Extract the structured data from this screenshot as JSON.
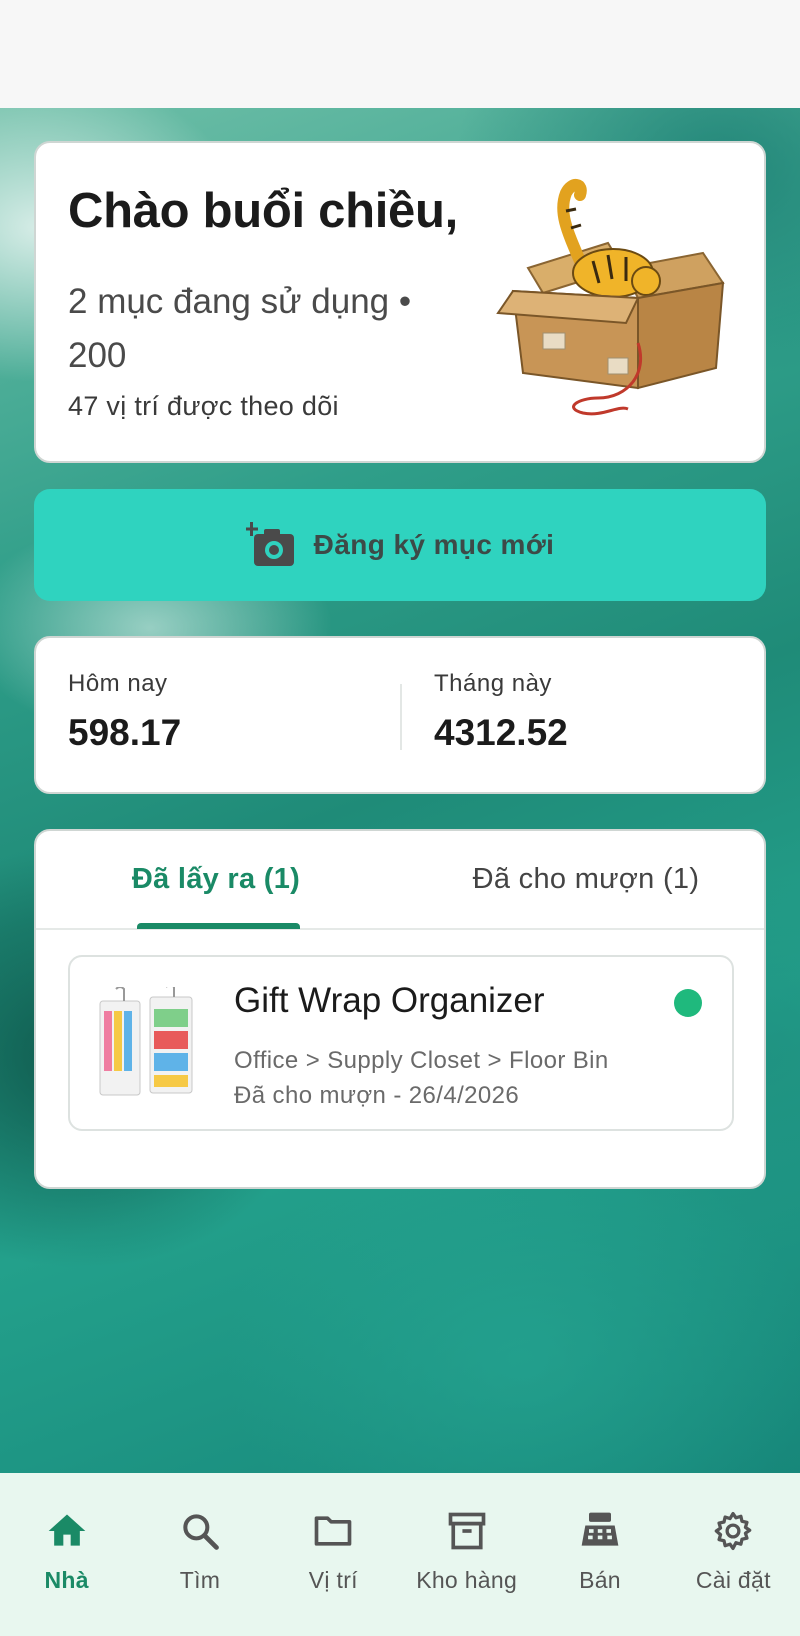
{
  "greeting": {
    "title": "Chào buổi chiều,",
    "items_line": "2 mục đang sử dụng • 200",
    "locations_line": "47 vị trí được theo dõi"
  },
  "register_button": {
    "label": "Đăng ký mục mới",
    "icon": "add-camera-icon"
  },
  "stats": {
    "today": {
      "label": "Hôm nay",
      "value": "598.17"
    },
    "month": {
      "label": "Tháng này",
      "value": "4312.52"
    }
  },
  "tabs": [
    {
      "label": "Đã lấy ra (1)",
      "active": true
    },
    {
      "label": "Đã cho mượn (1)",
      "active": false
    }
  ],
  "item": {
    "title": "Gift Wrap Organizer",
    "path": "Office > Supply Closet > Floor Bin",
    "status": "Đã cho mượn - 26/4/2026",
    "dot_color": "#1fb97d"
  },
  "bottom_nav": [
    {
      "label": "Nhà",
      "icon": "home-icon",
      "active": true
    },
    {
      "label": "Tìm",
      "icon": "search-icon",
      "active": false
    },
    {
      "label": "Vị trí",
      "icon": "folder-icon",
      "active": false
    },
    {
      "label": "Kho hàng",
      "icon": "archive-icon",
      "active": false
    },
    {
      "label": "Bán",
      "icon": "cash-register-icon",
      "active": false
    },
    {
      "label": "Cài đặt",
      "icon": "gear-icon",
      "active": false
    }
  ],
  "colors": {
    "accent": "#1a8a66",
    "button": "#2fd3bf",
    "nav_bg": "#e8f7ef"
  }
}
